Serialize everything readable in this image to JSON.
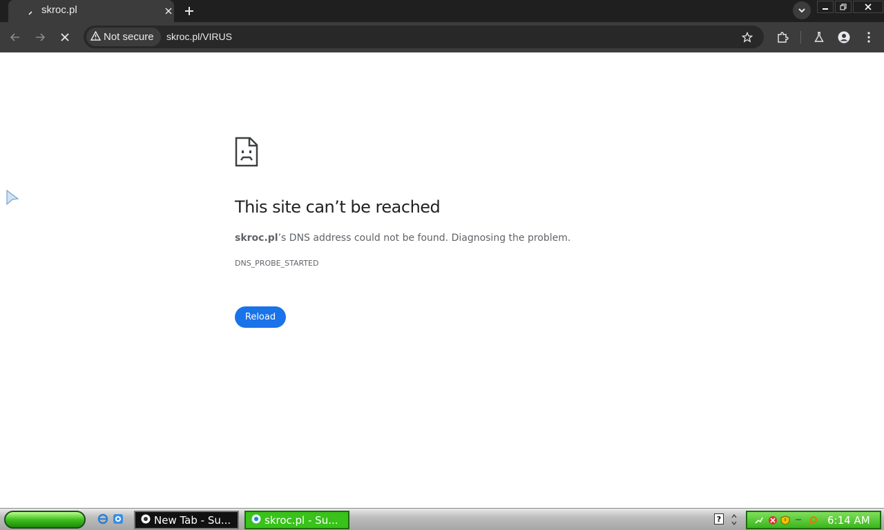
{
  "browser": {
    "tab": {
      "title": "skroc.pl"
    },
    "omnibox": {
      "security_chip": "Not secure",
      "url": "skroc.pl/VIRUS"
    }
  },
  "error_page": {
    "title": "This site can’t be reached",
    "host_bold": "skroc.pl",
    "description_rest": "’s DNS address could not be found. Diagnosing the problem.",
    "error_code": "DNS_PROBE_STARTED",
    "reload_label": "Reload"
  },
  "taskbar": {
    "tasks": [
      {
        "label": "New Tab - Su..."
      },
      {
        "label": "skroc.pl - Su..."
      }
    ],
    "tray_help": "?",
    "clock": "6:14 AM"
  },
  "colors": {
    "button_blue": "#1a73e8",
    "chrome_dark": "#3c3c3c",
    "xp_green": "#38c21a"
  }
}
